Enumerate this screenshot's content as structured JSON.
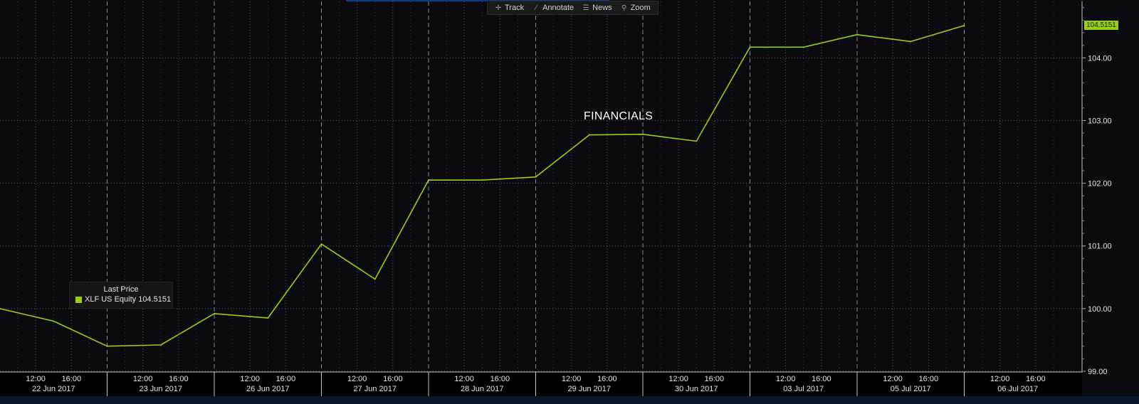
{
  "toolbar": {
    "items": [
      {
        "label": "Track",
        "icon": "crosshair-icon"
      },
      {
        "label": "Annotate",
        "icon": "pencil-icon"
      },
      {
        "label": "News",
        "icon": "news-icon"
      },
      {
        "label": "Zoom",
        "icon": "magnifier-icon"
      }
    ]
  },
  "colors": {
    "background": "#0b0b0f",
    "line": "#9acd16",
    "grid": "#5a5a5a",
    "axis_text": "#e6e6e6"
  },
  "chart_data": {
    "type": "line",
    "title": "FINANCIALS",
    "xlabel": "",
    "ylabel": "",
    "ylim": [
      99.0,
      104.9
    ],
    "y_ticks": [
      "99.00",
      "100.00",
      "101.00",
      "102.00",
      "103.00",
      "104.00"
    ],
    "grid": true,
    "legend_placement": "bottom-left",
    "legend": {
      "title": "Last Price",
      "entry": "XLF US Equity 104.5151"
    },
    "last_value_label": "104.5151",
    "x_axis": {
      "days": [
        "22 Jun 2017",
        "23 Jun 2017",
        "26 Jun 2017",
        "27 Jun 2017",
        "28 Jun 2017",
        "29 Jun 2017",
        "30 Jun 2017",
        "03 Jul 2017",
        "05 Jul 2017",
        "06 Jul 2017"
      ],
      "intraday_ticks": [
        "12:00",
        "16:00"
      ]
    },
    "series": [
      {
        "name": "XLF US Equity",
        "points": [
          {
            "t": "22 Jun 2017 08:00",
            "y": 100.0
          },
          {
            "t": "22 Jun 2017 14:00",
            "y": 99.8
          },
          {
            "t": "22 Jun 2017 20:00",
            "y": 99.4
          },
          {
            "t": "23 Jun 2017 14:00",
            "y": 99.42
          },
          {
            "t": "23 Jun 2017 20:00",
            "y": 99.92
          },
          {
            "t": "26 Jun 2017 14:00",
            "y": 99.85
          },
          {
            "t": "26 Jun 2017 20:00",
            "y": 101.03
          },
          {
            "t": "27 Jun 2017 14:00",
            "y": 100.47
          },
          {
            "t": "27 Jun 2017 20:00",
            "y": 102.05
          },
          {
            "t": "28 Jun 2017 14:00",
            "y": 102.05
          },
          {
            "t": "28 Jun 2017 20:00",
            "y": 102.1
          },
          {
            "t": "29 Jun 2017 14:00",
            "y": 102.77
          },
          {
            "t": "29 Jun 2017 20:00",
            "y": 102.78
          },
          {
            "t": "30 Jun 2017 14:00",
            "y": 102.67
          },
          {
            "t": "30 Jun 2017 20:00",
            "y": 104.17
          },
          {
            "t": "03 Jul 2017 14:00",
            "y": 104.17
          },
          {
            "t": "03 Jul 2017 20:00",
            "y": 104.37
          },
          {
            "t": "05 Jul 2017 14:00",
            "y": 104.26
          },
          {
            "t": "05 Jul 2017 20:00",
            "y": 104.5151
          }
        ]
      }
    ]
  }
}
